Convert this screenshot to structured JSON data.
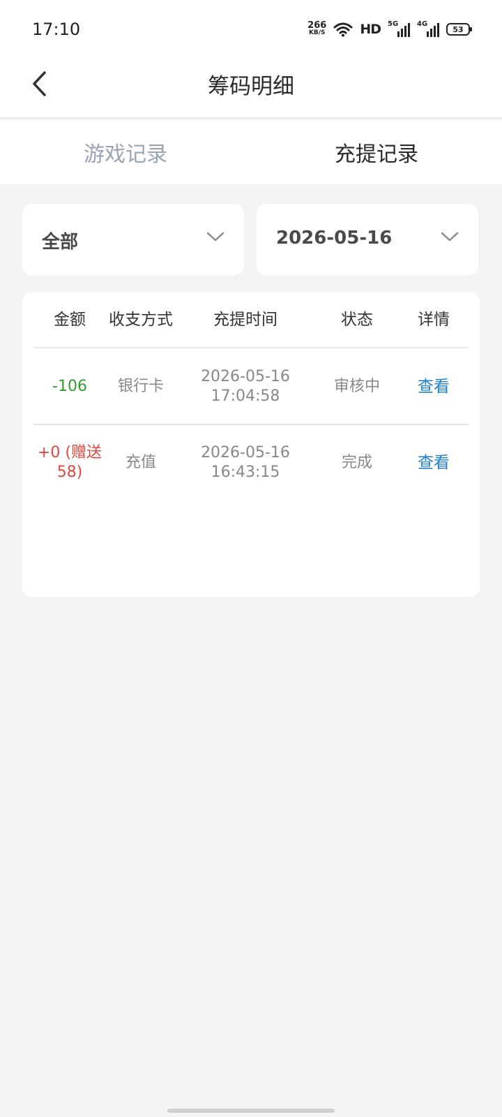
{
  "status_bar": {
    "time": "17:10",
    "net_speed_value": "266",
    "net_speed_unit": "KB/S",
    "hd_label": "HD",
    "sim1_label": "5G",
    "sim2_label": "4G",
    "battery_level": "53"
  },
  "header": {
    "title": "筹码明细",
    "back_icon": "chevron-left-icon"
  },
  "tabs": [
    {
      "label": "游戏记录",
      "active": false
    },
    {
      "label": "充提记录",
      "active": true
    }
  ],
  "filters": {
    "type_value": "全部",
    "date_value": "2026-05-16"
  },
  "table": {
    "columns": [
      "金额",
      "收支方式",
      "充提时间",
      "状态",
      "详情"
    ],
    "rows": [
      {
        "amount": "-106",
        "method": "银行卡",
        "date": "2026-05-16",
        "time": "17:04:58",
        "status": "审核中",
        "action": "查看"
      },
      {
        "amount_line1": "+0 (赠送",
        "amount_line2": "58)",
        "method": "充值",
        "date": "2026-05-16",
        "time": "16:43:15",
        "status": "完成",
        "action": "查看"
      }
    ]
  },
  "colors": {
    "negative_amount": "#2fa02f",
    "positive_amount": "#e0463c",
    "link": "#1e7fd8",
    "inactive_tab": "#98a4b6"
  }
}
